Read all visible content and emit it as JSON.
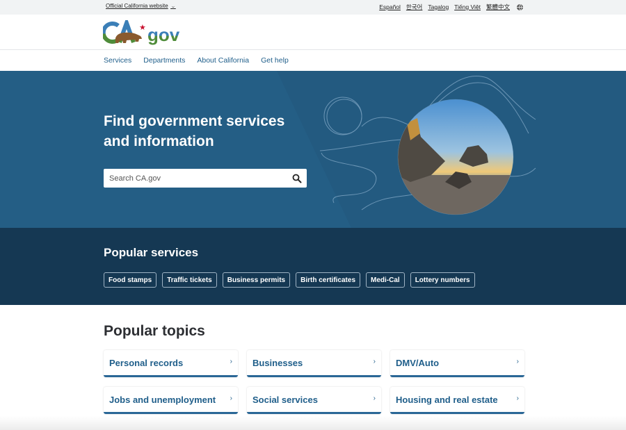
{
  "utility": {
    "official_label": "Official California website",
    "languages": [
      "Español",
      "한국어",
      "Tagalog",
      "Tiếng Việt",
      "繁體中文"
    ],
    "globe_icon": "globe-icon"
  },
  "brand": {
    "logo_text_ca": "CA",
    "logo_text_gov": "gov"
  },
  "nav": {
    "items": [
      "Services",
      "Departments",
      "About California",
      "Get help"
    ]
  },
  "hero": {
    "title": "Find government services and information",
    "search_placeholder": "Search CA.gov",
    "search_value": "",
    "search_icon": "search-icon"
  },
  "popular_services": {
    "title": "Popular services",
    "items": [
      "Food stamps",
      "Traffic tickets",
      "Business permits",
      "Birth certificates",
      "Medi-Cal",
      "Lottery numbers"
    ]
  },
  "popular_topics": {
    "title": "Popular topics",
    "items": [
      "Personal records",
      "Businesses",
      "DMV/Auto",
      "Jobs and unemployment",
      "Social services",
      "Housing and real estate"
    ],
    "chevron": "›"
  },
  "colors": {
    "hero_bg": "#235a80",
    "hero_light": "#245e85",
    "services_bg": "#153853",
    "link": "#1f5e8a",
    "card_accent": "#2a6796"
  }
}
